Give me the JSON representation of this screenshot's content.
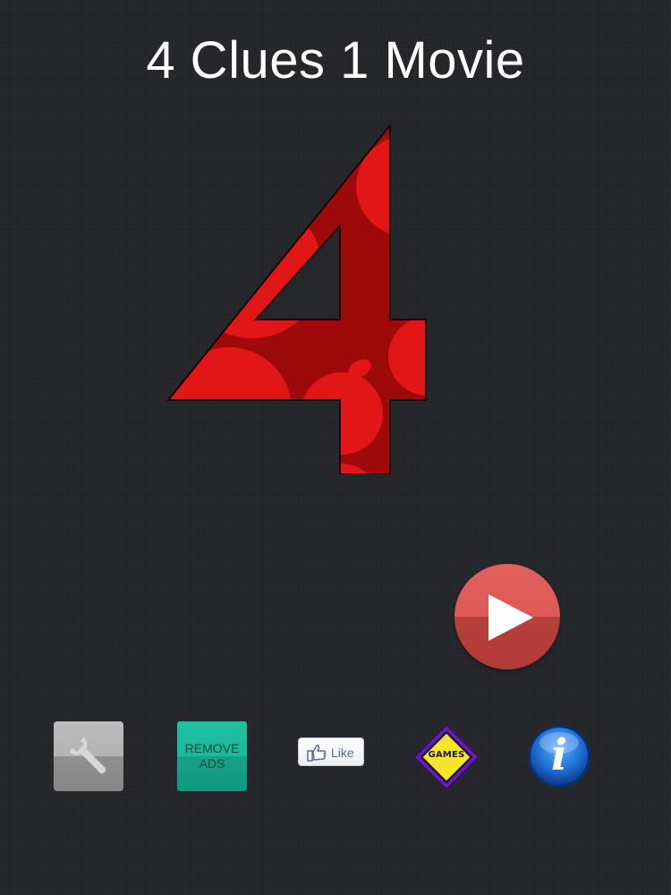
{
  "app": {
    "title": "4 Clues 1 Movie"
  },
  "logo": {
    "glyph": "4",
    "icon": "four-logo-icon",
    "colors": {
      "dark_red": "#9e0a0a",
      "bright_red": "#e21616",
      "outline": "#1a0606"
    }
  },
  "play": {
    "icon": "play-icon",
    "color_top": "#e0605c",
    "color_bottom": "#b23b37"
  },
  "bottom_bar": {
    "settings": {
      "icon": "wrench-icon",
      "color": "#b3b3b3"
    },
    "remove_ads": {
      "label": "REMOVE\nADS",
      "color": "#1db79a"
    },
    "like": {
      "icon": "thumbs-up-icon",
      "label": "Like"
    },
    "games": {
      "icon": "games-diamond-icon",
      "label": "GAMES",
      "color_fill": "#f5e62a",
      "color_border": "#7b2cc4"
    },
    "info": {
      "icon": "info-icon",
      "glyph": "i",
      "color": "#1f6fd6"
    }
  },
  "background": {
    "color": "#26272b"
  }
}
